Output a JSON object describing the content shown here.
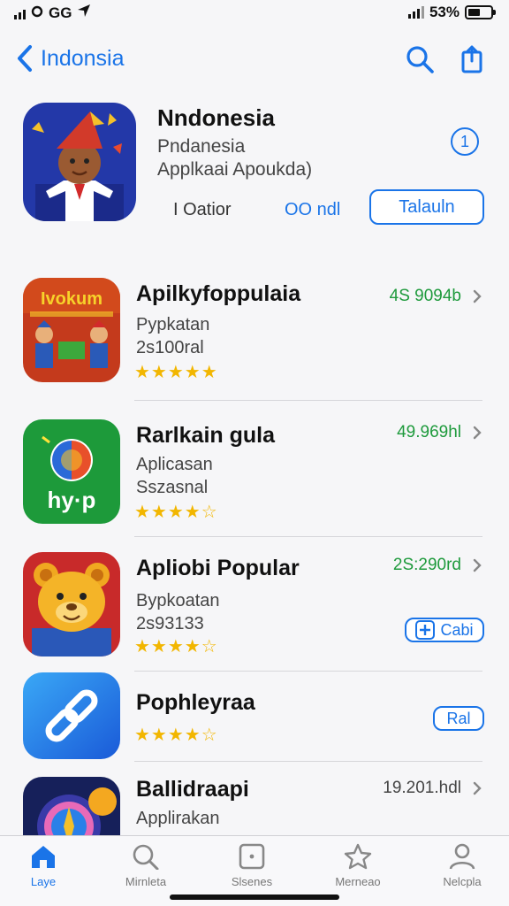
{
  "status": {
    "carrier": "GG",
    "battery": "53%",
    "battery_level": 0.53
  },
  "nav": {
    "back_label": "Indonsia"
  },
  "hero": {
    "title": "Nndonesia",
    "subtitle": "Pndanesia",
    "category": "Applkaai Apoukda)",
    "badge": "1",
    "rating_label": "I Oatior",
    "rank": "OO ndl",
    "get_label": "Talauln"
  },
  "apps": [
    {
      "name": "Apilkyfoppulaia",
      "category": "Pypkatan",
      "meta": "2s100ral",
      "stars": "★★★★★",
      "rating": 5,
      "price": "4S 9094b",
      "icon_name": "ivokum-app-icon",
      "icon_text": "Ivokum"
    },
    {
      "name": "Rarlkain gula",
      "category": "Aplicasan",
      "meta": "Sszasnal",
      "stars": "★★★★☆",
      "rating": 4,
      "price": "49.969hl",
      "icon_name": "hyp-app-icon",
      "icon_text": "hy·p"
    },
    {
      "name": "Apliobi Popular",
      "category": "Bypkoatan",
      "meta": "2s93133",
      "stars": "★★★★☆",
      "rating": 4,
      "price": "2S:290rd",
      "button": "Cabi",
      "icon_name": "bear-app-icon"
    },
    {
      "name": "Pophleyraa",
      "stars": "★★★★☆",
      "rating": 4,
      "button": "Ral",
      "icon_name": "link-app-icon"
    },
    {
      "name": "Ballidraapi",
      "category": "Applirakan",
      "price": "19.201.hdl",
      "icon_name": "compass-app-icon"
    }
  ],
  "tabs": [
    {
      "label": "Laye",
      "active": true,
      "icon": "home-icon"
    },
    {
      "label": "Mirnleta",
      "active": false,
      "icon": "search-icon"
    },
    {
      "label": "Slsenes",
      "active": false,
      "icon": "square-icon"
    },
    {
      "label": "Merneao",
      "active": false,
      "icon": "star-icon"
    },
    {
      "label": "Nelcpla",
      "active": false,
      "icon": "person-icon"
    }
  ],
  "colors": {
    "accent": "#1a74e8",
    "green": "#1e9a3c",
    "star": "#f2b600"
  }
}
